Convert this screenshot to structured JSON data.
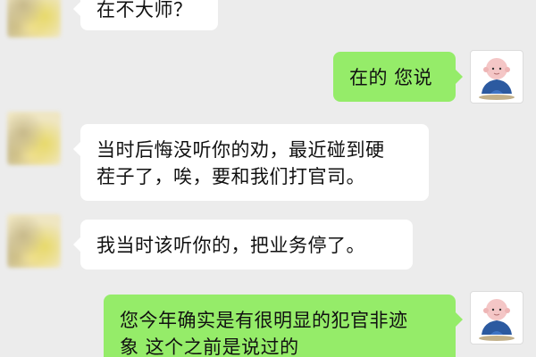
{
  "colors": {
    "background": "#ececec",
    "incoming_bubble": "#ffffff",
    "outgoing_bubble": "#95ec69"
  },
  "messages": [
    {
      "side": "incoming",
      "avatar_icon": "blurred-avatar-icon",
      "lines": [
        "在不大师？"
      ]
    },
    {
      "side": "outgoing",
      "avatar_icon": "monk-avatar-icon",
      "lines": [
        "在的 您说"
      ]
    },
    {
      "side": "incoming",
      "avatar_icon": "blurred-avatar-icon",
      "lines": [
        "当时后悔没听你的劝，最近碰到硬",
        "茬子了，唉，要和我们打官司。"
      ]
    },
    {
      "side": "incoming",
      "avatar_icon": "blurred-avatar-icon",
      "lines": [
        "我当时该听你的，把业务停了。"
      ]
    },
    {
      "side": "outgoing",
      "avatar_icon": "monk-avatar-icon",
      "lines": [
        "您今年确实是有很明显的犯官非迹",
        "象 这个之前是说过的"
      ]
    }
  ]
}
